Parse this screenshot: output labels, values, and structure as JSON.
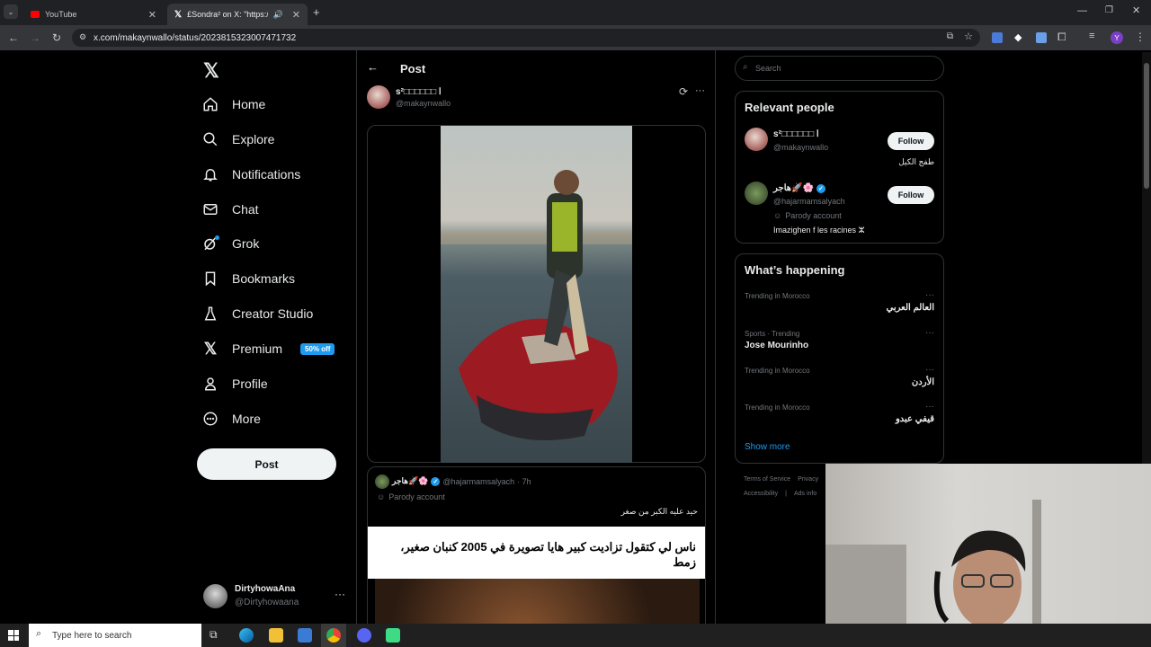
{
  "browser": {
    "tabs": [
      {
        "label": "YouTube"
      },
      {
        "label": "£Sondra² on X: \"https://t.c"
      }
    ],
    "url": "x.com/makaynwallo/status/2023815323007471732"
  },
  "nav": {
    "items": [
      {
        "label": "Home"
      },
      {
        "label": "Explore"
      },
      {
        "label": "Notifications"
      },
      {
        "label": "Chat"
      },
      {
        "label": "Grok"
      },
      {
        "label": "Bookmarks"
      },
      {
        "label": "Creator Studio"
      },
      {
        "label": "Premium",
        "badge": "50% off"
      },
      {
        "label": "Profile"
      },
      {
        "label": "More"
      }
    ],
    "post_button": "Post",
    "account": {
      "name": "DirtyhowaAna",
      "handle": "@Dirtyhowaana"
    }
  },
  "post": {
    "header_title": "Post",
    "author_name": "sا □□□□□□²",
    "author_handle": "@makaynwallo"
  },
  "quote": {
    "author_name": "هاجر🚀🌸",
    "author_handle": "@hajarmamsalyach",
    "time": "· 7h",
    "parody_label": "Parody account",
    "text": "حيد عليه الكبر من صغر",
    "headline": "ناس لي كتقول تزاديت كبير هايا تصويرة في 2005 كنبان صغير، زمط"
  },
  "right": {
    "search_placeholder": "Search",
    "relevant": {
      "title": "Relevant people",
      "people": [
        {
          "name": "sا □□□□□□²",
          "handle": "@makaynwallo",
          "bio": "طفج الكيل",
          "follow": "Follow"
        },
        {
          "name": "هاجر🚀🌸",
          "handle": "@hajarmamsalyach",
          "parody": "Parody account",
          "bio": "Imazighen f les racines ⵣ",
          "follow": "Follow"
        }
      ]
    },
    "happening": {
      "title": "What’s happening",
      "trends": [
        {
          "meta": "Trending in Morocco",
          "name": "العالم العربي"
        },
        {
          "meta": "Sports · Trending",
          "name": "Jose Mourinho"
        },
        {
          "meta": "Trending in Morocco",
          "name": "الأردن"
        },
        {
          "meta": "Trending in Morocco",
          "name": "قيفي عبدو"
        }
      ],
      "show_more": "Show more"
    },
    "footer": {
      "terms": "Terms of Service",
      "privacy": "Privacy",
      "accessibility": "Accessibility",
      "ads": "Ads info"
    }
  },
  "taskbar": {
    "search_placeholder": "Type here to search"
  }
}
